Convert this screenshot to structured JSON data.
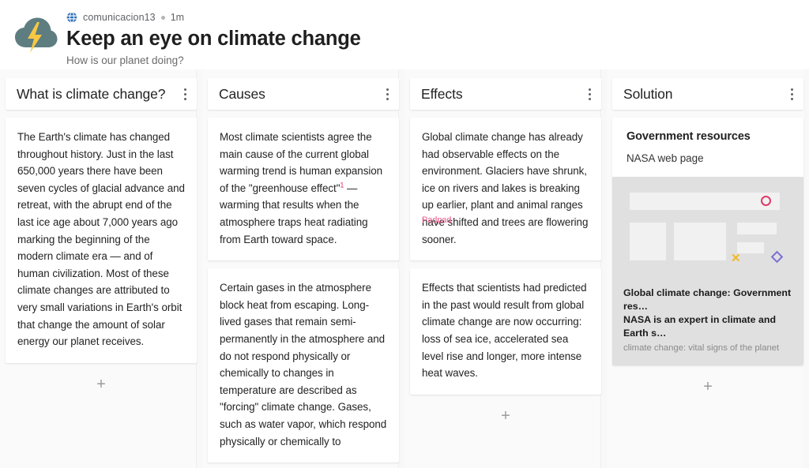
{
  "header": {
    "logo_icon": "cloud-lightning-icon",
    "avatar_icon": "globe-avatar-icon",
    "author": "comunicacion13",
    "time": "1m",
    "title": "Keep an eye on climate change",
    "subtitle": "How is our planet doing?"
  },
  "collaborator": {
    "label": "Padpad",
    "color": "#f05b8e"
  },
  "add_label": "+",
  "columns": [
    {
      "title": "What is climate change?",
      "menu_icon": "kebab-menu-icon",
      "cards": [
        {
          "type": "text",
          "text_before": "The Earth's climate has changed throughout history. Just in the last 650,000 years there have been seven cycles of glacial advance and retreat, with the abrupt end of the last ice age about 7,000 years ago marking the beginning of the modern climate era — and of human civilization. Most of these climate changes are attributed to very small variations in Earth's orbit that change the amount of solar energy our planet receives."
        }
      ]
    },
    {
      "title": "Causes",
      "menu_icon": "kebab-menu-icon",
      "cards": [
        {
          "type": "text-ref",
          "text_before": "Most climate scientists agree the main cause of the current global warming trend is human expansion of the \"greenhouse effect\"",
          "ref": "1",
          "text_after": " — warming that results when the atmosphere traps heat radiating from Earth toward space."
        },
        {
          "type": "text",
          "text_before": "Certain gases in the atmosphere block heat from escaping. Long-lived gases that remain semi-permanently in the atmosphere and do not respond physically or chemically to changes in temperature are described as \"forcing\" climate change. Gases, such as water vapor, which respond physically or chemically to"
        }
      ]
    },
    {
      "title": "Effects",
      "menu_icon": "kebab-menu-icon",
      "cards": [
        {
          "type": "text",
          "text_before": "Global climate change has already had observable effects on the environment. Glaciers have shrunk, ice on rivers and lakes is breaking up earlier, plant and animal ranges have shifted and trees are flowering sooner."
        },
        {
          "type": "text",
          "text_before": "Effects that scientists had predicted in the past would result from global climate change are now occurring: loss of sea ice, accelerated sea level rise and longer, more intense heat waves."
        }
      ]
    },
    {
      "title": "Solution",
      "menu_icon": "kebab-menu-icon",
      "cards": [
        {
          "type": "link",
          "heading": "Government resources",
          "subheading": "NASA web page",
          "preview": {
            "title": "Global climate change: Government res…",
            "description": "NASA is an expert in climate and Earth s…",
            "site": "climate change: vital signs of the planet",
            "shapes": {
              "circle_color": "#e03a68",
              "x_color": "#f2b827",
              "x_glyph": "✕",
              "diamond_color": "#7b6fd4"
            }
          }
        }
      ]
    }
  ]
}
